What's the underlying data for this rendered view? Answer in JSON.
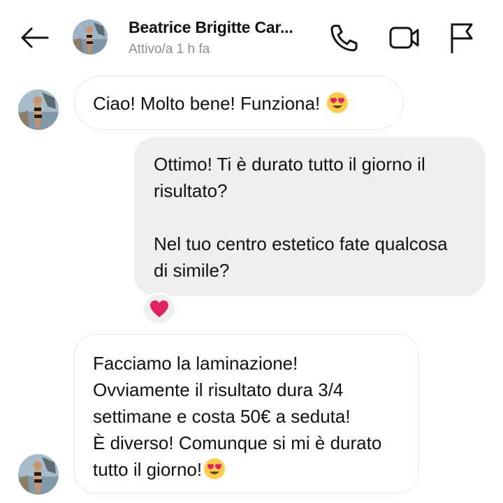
{
  "header": {
    "contact_name": "Beatrice Brigitte Car...",
    "status": "Attivo/a 1 h fa"
  },
  "messages": [
    {
      "sender": "contact",
      "text": "Ciao! Molto bene! Funziona!",
      "emoji": "heart-eyes-emoji"
    },
    {
      "sender": "me",
      "text": "Ottimo! Ti è durato tutto il giorno il risultato?\n\nNel tuo centro estetico fate qualcosa di simile?",
      "reaction": "red-heart-emoji"
    },
    {
      "sender": "contact",
      "text": "Facciamo la laminazione!\nOvviamente il risultato dura 3/4 settimane e costa 50€ a seduta!\nÈ diverso! Comunque si mi è durato tutto il giorno!",
      "emoji": "heart-eyes-emoji"
    }
  ],
  "icons": {
    "back": "arrow-left-icon",
    "call": "phone-icon",
    "video": "video-camera-icon",
    "report": "flag-icon"
  },
  "colors": {
    "sent_bubble": "#efefef",
    "received_border": "#e6e6e6",
    "status_text": "#8e8e8e",
    "heart": "#e0245e"
  }
}
